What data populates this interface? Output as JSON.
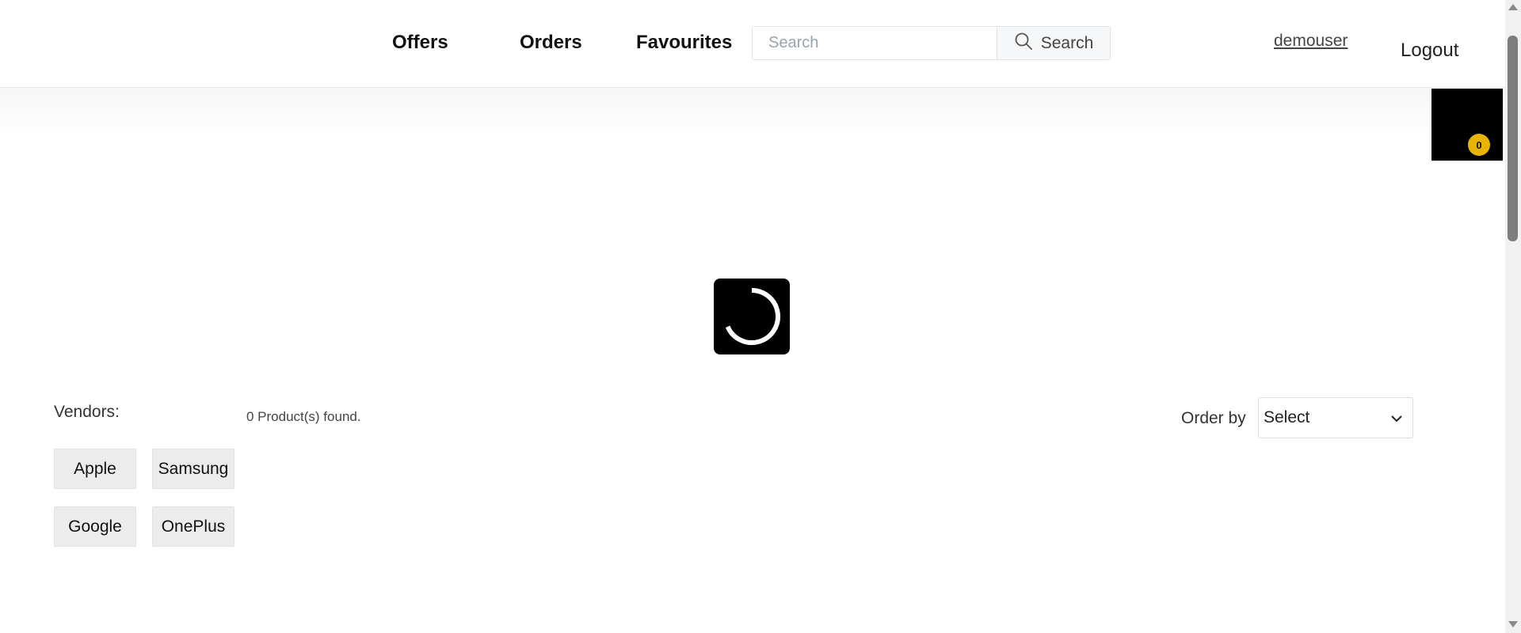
{
  "header": {
    "nav": {
      "offers": "Offers",
      "orders": "Orders",
      "favourites": "Favourites"
    },
    "search": {
      "placeholder": "Search",
      "value": "",
      "button_label": "Search",
      "button_icon": "search-icon"
    },
    "user": "demouser",
    "logout": "Logout"
  },
  "cart": {
    "count": "0",
    "badge_color": "#e8b400"
  },
  "loading": {
    "icon": "spinner-icon"
  },
  "filters": {
    "vendors_label": "Vendors:",
    "vendors": [
      "Apple",
      "Samsung",
      "Google",
      "OnePlus"
    ],
    "products_found": "0 Product(s) found.",
    "order_by_label": "Order by",
    "order_by_value": "Select",
    "order_by_icon": "chevron-down-icon"
  }
}
